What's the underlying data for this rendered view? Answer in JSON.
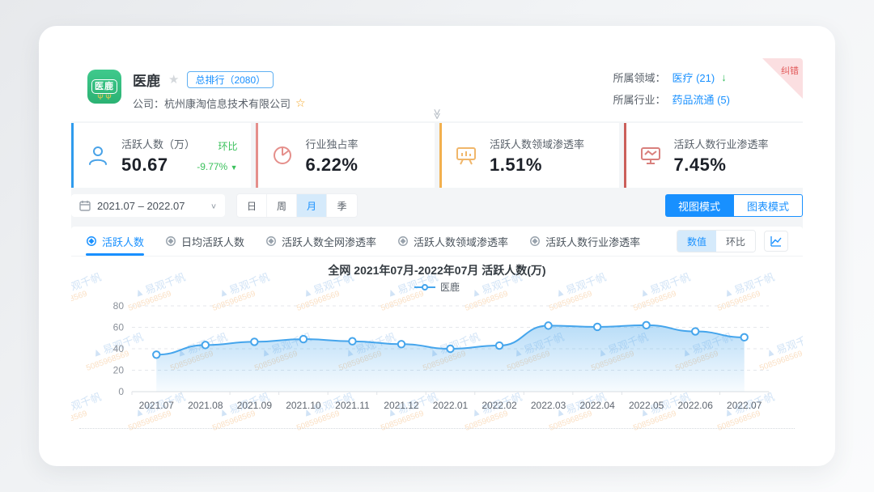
{
  "header": {
    "app_name": "医鹿",
    "app_icon_text": "医鹿",
    "rank_badge": "总排行（2080）",
    "company": "公司：杭州康淘信息技术有限公司",
    "field_label": "所属领域：",
    "field_value": "医疗 (21)",
    "industry_label": "所属行业：",
    "industry_value": "药品流通 (5)",
    "correction": "纠错"
  },
  "metric_cards": [
    {
      "title": "活跃人数（万）",
      "value": "50.67",
      "trend_label": "环比",
      "trend_value": "-9.77%",
      "accent": "#2f9bed"
    },
    {
      "title": "行业独占率",
      "value": "6.22%",
      "accent": "#e58f8b"
    },
    {
      "title": "活跃人数领域渗透率",
      "value": "1.51%",
      "accent": "#f2b04e"
    },
    {
      "title": "活跃人数行业渗透率",
      "value": "7.45%",
      "accent": "#cb5f5b"
    }
  ],
  "controls": {
    "date_range": "2021.07 – 2022.07",
    "periods": [
      "日",
      "周",
      "月",
      "季"
    ],
    "period_selected": "月",
    "mode_view": "视图模式",
    "mode_chart": "图表模式"
  },
  "tabs": [
    "活跃人数",
    "日均活跃人数",
    "活跃人数全网渗透率",
    "活跃人数领域渗透率",
    "活跃人数行业渗透率"
  ],
  "toggle": {
    "value": "数值",
    "ratio": "环比"
  },
  "chart_data": {
    "type": "line",
    "title": "全网 2021年07月-2022年07月 活跃人数(万)",
    "categories": [
      "2021.07",
      "2021.08",
      "2021.09",
      "2021.10",
      "2021.11",
      "2021.12",
      "2022.01",
      "2022.02",
      "2022.03",
      "2022.04",
      "2022.05",
      "2022.06",
      "2022.07"
    ],
    "series": [
      {
        "name": "医鹿",
        "values": [
          34.5,
          43.5,
          46.5,
          49.0,
          47.0,
          44.3,
          40.0,
          43.0,
          61.6,
          60.4,
          62.0,
          56.2,
          50.67
        ]
      }
    ],
    "ylim": [
      0,
      80
    ],
    "yticks": [
      0,
      20,
      40,
      60,
      80
    ],
    "grid": "horizontal-dashed",
    "legend_position": "top-center",
    "line_color": "#45a5ec"
  },
  "watermark": {
    "text": "易观千帆",
    "number": "5085968569"
  },
  "icons": {
    "fav_star": "★",
    "company_star": "☆",
    "field_down_arrow": "↓",
    "trend_down": "▼",
    "chevron_down": "∨",
    "collapse": "≫",
    "antlers": "Ψ Ψ"
  }
}
